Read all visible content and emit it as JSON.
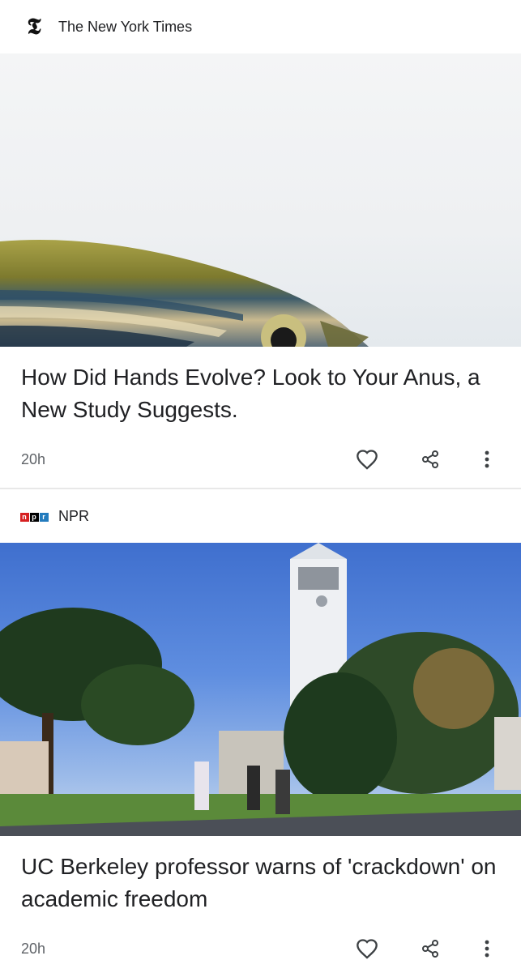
{
  "articles": [
    {
      "source": "The New York Times",
      "source_logo": "nyt-logo",
      "image": "zebrafish-photo",
      "headline": "How Did Hands Evolve? Look to Your Anus, a New Study Suggests.",
      "time": "20h",
      "actions": [
        "heart-icon",
        "share-icon",
        "more-vert-icon"
      ]
    },
    {
      "source": "NPR",
      "source_logo": "npr-logo",
      "image": "uc-berkeley-sather-tower-photo",
      "headline": "UC Berkeley professor warns of 'crackdown' on academic freedom",
      "time": "20h",
      "actions": [
        "heart-icon",
        "share-icon",
        "more-vert-icon"
      ]
    }
  ],
  "logos": {
    "nyt_glyph": "𝕿",
    "npr_letters": [
      "n",
      "p",
      "r"
    ]
  },
  "colors": {
    "npr_n": "#d62021",
    "npr_p": "#000000",
    "npr_r": "#237bbd"
  }
}
